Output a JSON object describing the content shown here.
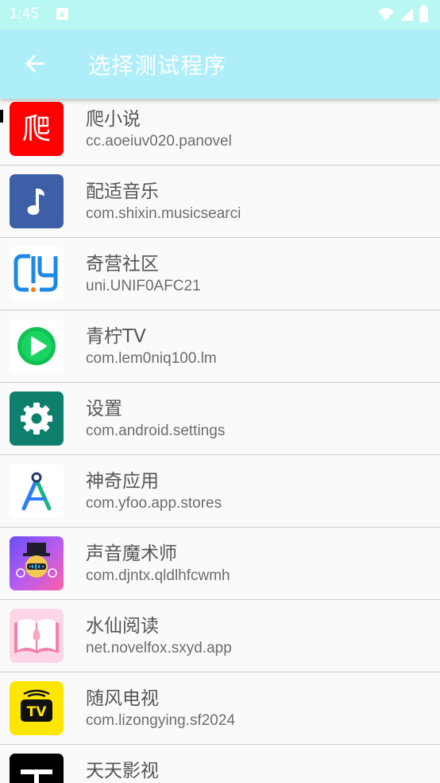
{
  "status_bar": {
    "time": "1:45",
    "notification_icon": "a-notification-icon",
    "wifi_icon": "wifi-icon",
    "signal_icon": "signal-icon",
    "battery_icon": "battery-icon",
    "color": "#b8f7f2"
  },
  "app_bar": {
    "title": "选择测试程序",
    "back_icon": "arrow-back-icon",
    "color": "#aeeef9"
  },
  "apps": [
    {
      "name": "爬小说",
      "package": "cc.aoeiuv020.panovel",
      "icon": "pa-novel-icon",
      "icon_text": "爬"
    },
    {
      "name": "配适音乐",
      "package": "com.shixin.musicsearci",
      "icon": "music-note-icon"
    },
    {
      "name": "奇营社区",
      "package": "uni.UNIF0AFC21",
      "icon": "qiying-logo-icon"
    },
    {
      "name": "青柠TV",
      "package": "com.lem0niq100.lm",
      "icon": "play-circle-icon"
    },
    {
      "name": "设置",
      "package": "com.android.settings",
      "icon": "settings-gear-icon"
    },
    {
      "name": "神奇应用",
      "package": "com.yfoo.app.stores",
      "icon": "compass-a-icon"
    },
    {
      "name": "声音魔术师",
      "package": "com.djntx.qldlhfcwmh",
      "icon": "voice-magician-icon"
    },
    {
      "name": "水仙阅读",
      "package": "net.novelfox.sxyd.app",
      "icon": "open-book-icon"
    },
    {
      "name": "随风电视",
      "package": "com.lizongying.sf2024",
      "icon": "tv-icon",
      "icon_text": "TV"
    },
    {
      "name": "天天影视",
      "package": "",
      "icon": "tiantian-t-icon"
    }
  ]
}
